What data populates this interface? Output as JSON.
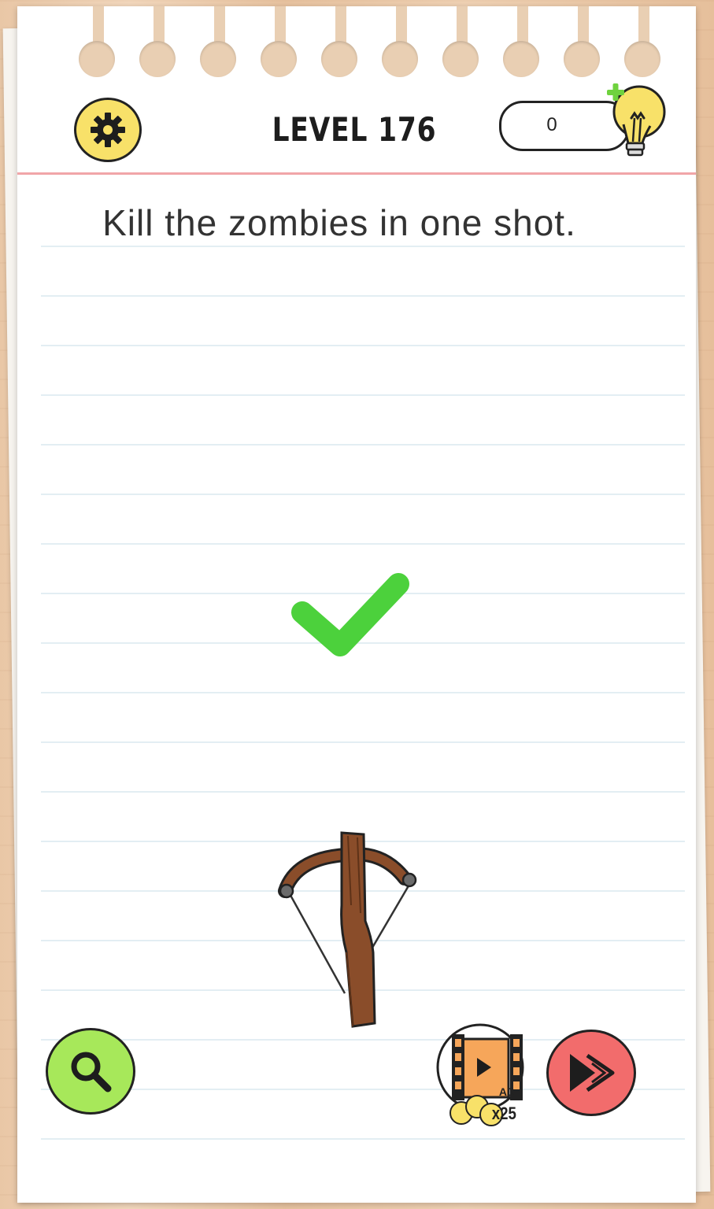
{
  "header": {
    "level_label": "LEVEL 176",
    "hint_count": "0",
    "settings_icon": "gear-icon",
    "hint_icon": "lightbulb-plus-icon"
  },
  "puzzle": {
    "prompt": "Kill the zombies in one shot.",
    "result_icon": "checkmark-icon",
    "weapon": "crossbow"
  },
  "footer": {
    "search_icon": "magnifier-icon",
    "ad_label": "AD",
    "ad_reward": "x25",
    "skip_icon": "skip-forward-icon"
  },
  "colors": {
    "settings_yellow": "#f8e169",
    "search_green": "#a7e85a",
    "skip_red": "#f26c6c",
    "check_green": "#4cd13c",
    "ad_orange": "#f6a65a",
    "margin_red": "#f1a5a8"
  }
}
